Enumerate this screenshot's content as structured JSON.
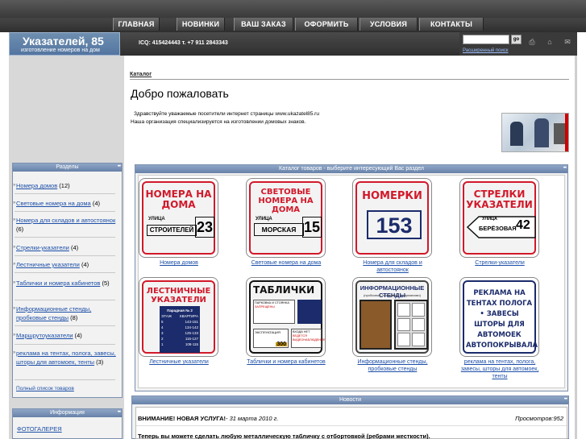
{
  "nav": [
    "ГЛАВНАЯ",
    "НОВИНКИ",
    "ВАШ ЗАКАЗ",
    "ОФОРМИТЬ",
    "УСЛОВИЯ",
    "КОНТАКТЫ"
  ],
  "logo": {
    "title": "Указателей, 85",
    "subtitle": "изготовление номеров на дом"
  },
  "contact": "ICQ: 415424443 т. +7 911 2843343",
  "search": {
    "go": "go",
    "advanced": "Расширенный поиск",
    "placeholder": ""
  },
  "breadcrumb": "Каталог",
  "welcome": {
    "title": "Добро пожаловать",
    "line1": "Здравствуйте уважаемые посетители интернет страницы www.ukazatel85.ru",
    "line2": "Наша организация специализируется на изготовлении домовых знаков."
  },
  "sections": {
    "title": "Разделы",
    "items": [
      {
        "label": "Номера домов",
        "count": "(12)"
      },
      {
        "label": "Световые номера на дома",
        "count": "(4)"
      },
      {
        "label": "Номера для складов и автостоянок",
        "count": "(6)"
      },
      {
        "label": "Стрелки-указатели",
        "count": "(4)"
      },
      {
        "label": "Лестничные указатели",
        "count": "(4)"
      },
      {
        "label": "Таблички и номера кабинетов",
        "count": "(5)"
      },
      {
        "label": "Информационные стенды, пробковые стенды",
        "count": "(8)"
      },
      {
        "label": "Маршрутоуказатели",
        "count": "(4)"
      },
      {
        "label": "реклама на тентах, полога, завесы, шторы для автомоек, тенты",
        "count": "(3)"
      }
    ],
    "full_list": "Полный список товаров"
  },
  "info": {
    "title": "Информация",
    "item": "ФОТОГАЛЕРЕЯ"
  },
  "catalog": {
    "title": "Каталог товаров - выберите интересующий Вас раздел",
    "tiles": [
      {
        "caption": "Номера домов",
        "sign": "НОМЕРА НА ДОМА",
        "street": "СТРОИТЕЛЕЙ",
        "num": "23"
      },
      {
        "caption": "Световые номера на дома",
        "sign": "СВЕТОВЫЕ НОМЕРА НА ДОМА",
        "street": "МОРСКАЯ",
        "num": "15"
      },
      {
        "caption": "Номера для складов и автостоянок",
        "sign": "НОМЕРКИ",
        "street": "",
        "num": "153"
      },
      {
        "caption": "Стрелки-указатели",
        "sign": "СТРЕЛКИ УКАЗАТЕЛИ",
        "street": "БЕРЁЗОВАЯ",
        "num": "42"
      },
      {
        "caption": "Лестничные указатели",
        "sign": "ЛЕСТНИЧНЫЕ УКАЗАТЕЛИ",
        "street": "Парадная № 2",
        "num": ""
      },
      {
        "caption": "Таблички и номера кабинетов",
        "sign": "ТАБЛИЧКИ",
        "street": "",
        "num": "300"
      },
      {
        "caption": "Информационные стенды, пробковые стенды",
        "sign": "ИНФОРМАЦИОННЫЕ СТЕНДЫ",
        "street": "(пробковые, глянцевые, с карманами)",
        "num": ""
      },
      {
        "caption": "реклама на тентах, полога, завесы, шторы для автомоек, тенты",
        "sign": "РЕКЛАМА НА ТЕНТАХ ПОЛОГА • ЗАВЕСЫ ШТОРЫ ДЛЯ АВТОМОЕК АВТОПОКРЫВАЛА",
        "street": "",
        "num": ""
      }
    ],
    "house_label": "УЛИЦА",
    "stairs_rows": [
      "ЭТАЖ",
      "КВАРТИРА",
      "5",
      "143-151",
      "4",
      "134-142",
      "3",
      "125-133",
      "2",
      "116-127",
      "1",
      "108-115"
    ],
    "tablichki_lines": [
      "ПАРКОВКА И СТОЯНКА",
      "ЗАПРЕЩЕНЫ",
      "ЭКСПЛУАТАЦИЯ",
      "ВХОДА НЕТ",
      "ВЕДЕТСЯ ВИДЕОНАБЛЮДЕНИЕ"
    ]
  },
  "news": {
    "title": "Новости",
    "headline": "ВНИМАНИЕ! НОВАЯ УСЛУГА!",
    "date": "- 31 марта 2010 г.",
    "views": "Просмотров:952",
    "text": "Теперь вы можете сделать любую металлическую табличку с отбортовкой (ребрами жесткости)."
  }
}
